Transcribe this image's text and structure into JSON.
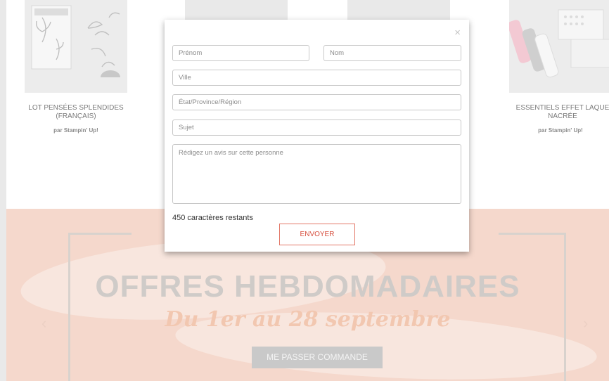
{
  "products": [
    {
      "name": "LOT PENSÉES SPLENDIDES (FRANÇAIS)",
      "by": "par Stampin' Up!"
    },
    {
      "name": "ESSENTIELS EFFET LAQUE NACRÉE",
      "by": "par Stampin' Up!"
    }
  ],
  "banner": {
    "title": "OFFRES HEBDOMADAIRES",
    "subtitle": "Du 1er au 28 septembre",
    "cta_label": "ME PASSER COMMANDE",
    "prev_icon": "chevron-left-icon",
    "next_icon": "chevron-right-icon"
  },
  "modal": {
    "close_icon": "close-icon",
    "close_glyph": "×",
    "fields": {
      "first_name": "Prénom",
      "last_name": "Nom",
      "city": "Ville",
      "state": "État/Province/Région",
      "subject": "Sujet",
      "review": "Rédigez un avis sur cette personne"
    },
    "chars_remaining": "450 caractères restants",
    "send_label": "ENVOYER"
  },
  "colors": {
    "banner_bg": "#f5d8cc",
    "send_accent": "#d64d3c",
    "cta_bg": "#c9c9c9"
  }
}
